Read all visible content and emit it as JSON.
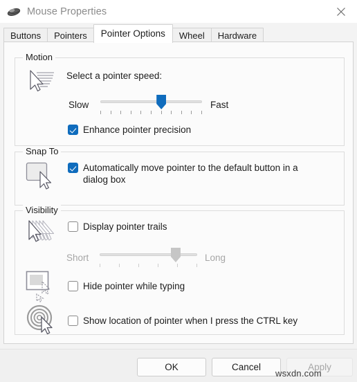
{
  "window": {
    "title": "Mouse Properties",
    "icon": "mouse-icon",
    "close_label": "✕",
    "accent_color": "#0f6cbd",
    "background_color": "#f3f3f3",
    "page_background": "#fbfbfb"
  },
  "tabs": [
    {
      "label": "Buttons",
      "selected": false
    },
    {
      "label": "Pointers",
      "selected": false
    },
    {
      "label": "Pointer Options",
      "selected": true
    },
    {
      "label": "Wheel",
      "selected": false
    },
    {
      "label": "Hardware",
      "selected": false
    }
  ],
  "groups": {
    "motion": {
      "label": "Motion",
      "icon": "pointer-speed-icon",
      "speed_caption": "Select a pointer speed:",
      "slider": {
        "min_label": "Slow",
        "max_label": "Fast",
        "value_percent": 60,
        "tick_count": 11,
        "enabled": true
      },
      "checkbox": {
        "label": "Enhance pointer precision",
        "checked": true
      }
    },
    "snapto": {
      "label": "Snap To",
      "icon": "snap-to-button-icon",
      "checkbox": {
        "label": "Automatically move pointer to the default button in a dialog box",
        "checked": true
      }
    },
    "visibility": {
      "label": "Visibility",
      "trails": {
        "icon": "pointer-trails-icon",
        "checkbox": {
          "label": "Display pointer trails",
          "checked": false
        },
        "slider": {
          "min_label": "Short",
          "max_label": "Long",
          "value_percent": 78,
          "tick_count": 6,
          "enabled": false
        }
      },
      "hide_typing": {
        "icon": "hide-pointer-typing-icon",
        "checkbox": {
          "label": "Hide pointer while typing",
          "checked": false
        }
      },
      "ctrl_locate": {
        "icon": "show-pointer-location-icon",
        "checkbox": {
          "label": "Show location of pointer when I press the CTRL key",
          "checked": false
        }
      }
    }
  },
  "footer": {
    "ok_label": "OK",
    "cancel_label": "Cancel",
    "apply_label": "Apply",
    "apply_enabled": false
  },
  "watermark": {
    "text": "wsxdn.com"
  }
}
